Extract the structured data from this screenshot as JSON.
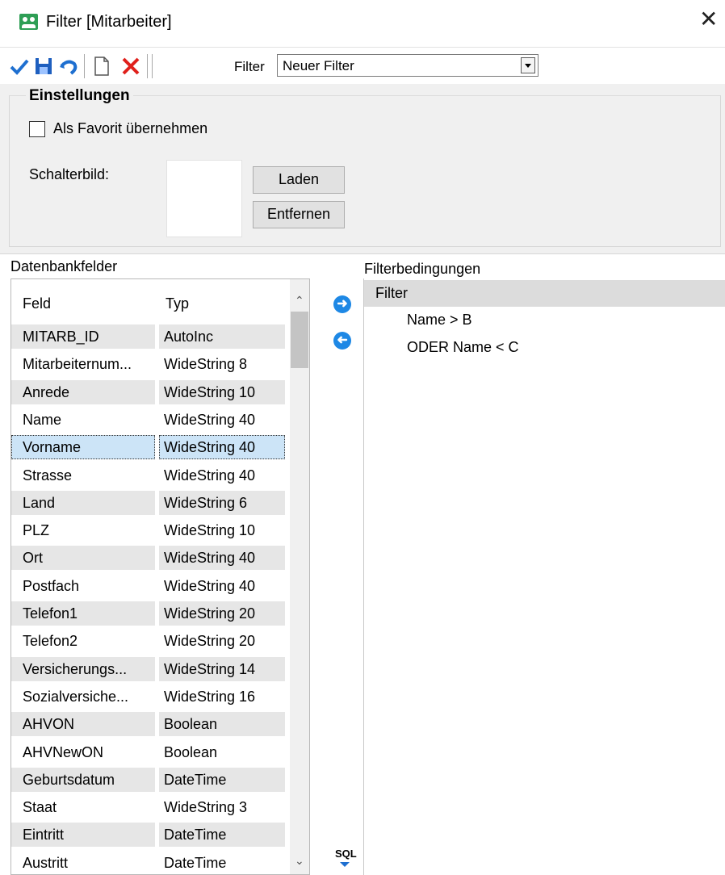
{
  "window": {
    "title": "Filter  [Mitarbeiter]"
  },
  "toolbar": {
    "filter_label": "Filter",
    "filter_value": "Neuer Filter"
  },
  "settings": {
    "group_title": "Einstellungen",
    "favorite_label": "Als Favorit übernehmen",
    "button_image_label": "Schalterbild:",
    "load_button": "Laden",
    "remove_button": "Entfernen"
  },
  "fields_panel": {
    "label": "Datenbankfelder",
    "col_field": "Feld",
    "col_type": "Typ",
    "rows": [
      {
        "f": "MITARB_ID",
        "t": "AutoInc"
      },
      {
        "f": "Mitarbeiternum...",
        "t": "WideString  8"
      },
      {
        "f": "Anrede",
        "t": "WideString 10"
      },
      {
        "f": "Name",
        "t": "WideString 40"
      },
      {
        "f": "Vorname",
        "t": "WideString 40"
      },
      {
        "f": "Strasse",
        "t": "WideString 40"
      },
      {
        "f": "Land",
        "t": "WideString  6"
      },
      {
        "f": "PLZ",
        "t": "WideString 10"
      },
      {
        "f": "Ort",
        "t": "WideString 40"
      },
      {
        "f": "Postfach",
        "t": "WideString 40"
      },
      {
        "f": "Telefon1",
        "t": "WideString 20"
      },
      {
        "f": "Telefon2",
        "t": "WideString 20"
      },
      {
        "f": "Versicherungs...",
        "t": "WideString 14"
      },
      {
        "f": "Sozialversiche...",
        "t": "WideString 16"
      },
      {
        "f": "AHVON",
        "t": "Boolean"
      },
      {
        "f": "AHVNewON",
        "t": "Boolean"
      },
      {
        "f": "Geburtsdatum",
        "t": "DateTime"
      },
      {
        "f": "Staat",
        "t": "WideString  3"
      },
      {
        "f": "Eintritt",
        "t": "DateTime"
      },
      {
        "f": "Austritt",
        "t": "DateTime"
      }
    ],
    "selected_row": 4
  },
  "middle": {
    "sql_label": "SQL"
  },
  "conditions_panel": {
    "label": "Filterbedingungen",
    "root": "Filter",
    "items": [
      "Name > B",
      "ODER Name < C"
    ]
  }
}
